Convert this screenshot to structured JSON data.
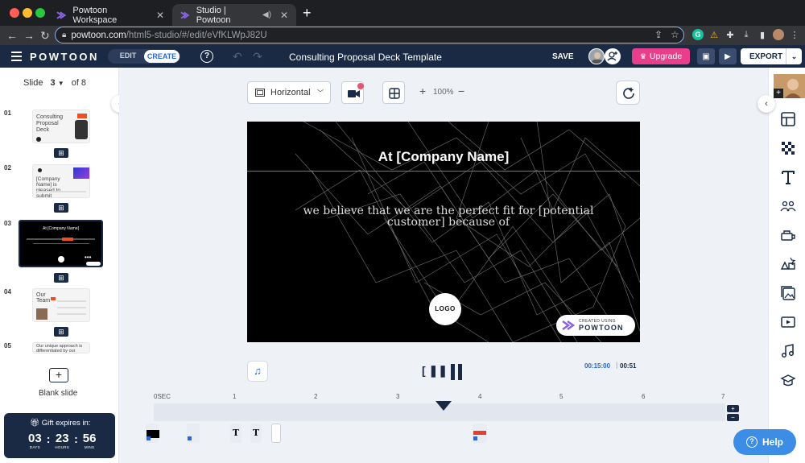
{
  "browser": {
    "tabs": [
      {
        "title": "Powtoon Workspace"
      },
      {
        "title": "Studio | Powtoon"
      }
    ],
    "url_host": "powtoon.com",
    "url_path": "/html5-studio/#/edit/eVfKLWpJ82U"
  },
  "header": {
    "brand": "POWTOON",
    "mode_edit": "EDIT",
    "mode_create": "CREATE",
    "help": "?",
    "title": "Consulting Proposal Deck Template",
    "save": "SAVE",
    "upgrade": "Upgrade",
    "export": "EXPORT"
  },
  "left_panel": {
    "slide_label": "Slide",
    "current_slide": "3",
    "of_label": "of 8",
    "slides": [
      {
        "no": "01",
        "text": "Consulting Proposal Deck"
      },
      {
        "no": "02",
        "text": "[Company Name] is pleased to submit"
      },
      {
        "no": "03",
        "text": "At [Company Name]"
      },
      {
        "no": "04",
        "text": "Our Team"
      },
      {
        "no": "05",
        "text": "Our unique approach is differentiated by our"
      }
    ],
    "blank_slide": "Blank slide",
    "gift": {
      "title": "Gift expires in:",
      "days": "03",
      "hours": "23",
      "mins": "56",
      "days_lbl": "DAYS",
      "hours_lbl": "HOURS",
      "mins_lbl": "MINS"
    }
  },
  "toolbar": {
    "orientation": "Horizontal",
    "zoom": "100%"
  },
  "canvas": {
    "title": "At [Company Name]",
    "body_line1": "we believe that we are the  perfect fit  for [potential",
    "body_line2": "customer] because of",
    "logo": "LOGO",
    "created_small": "CREATED USING",
    "created_brand": "POWTOON"
  },
  "playback": {
    "total_time": "00:15:00",
    "current_time": "00:51"
  },
  "timeline": {
    "labels": [
      "0SEC",
      "1",
      "2",
      "3",
      "4",
      "5",
      "6",
      "7"
    ],
    "zoom_in": "+",
    "zoom_out": "−",
    "text_layer": "T"
  },
  "help_button": "Help",
  "colors": {
    "navy": "#1a2a44",
    "accent_pink": "#e83e8c",
    "accent_blue": "#2a67d3",
    "help_blue": "#3b8de6"
  }
}
